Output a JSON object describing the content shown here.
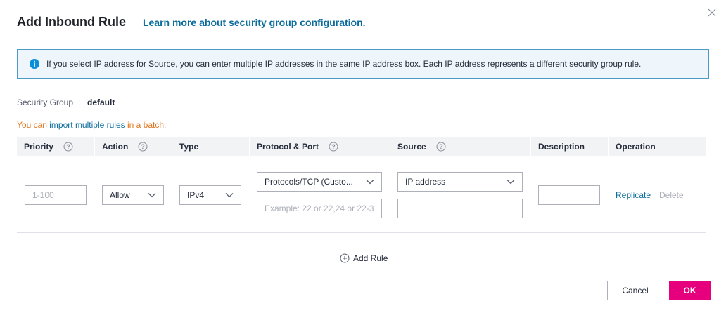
{
  "dialog": {
    "title": "Add Inbound Rule",
    "learn_more_link": "Learn more about security group configuration.",
    "close_icon": "close-icon"
  },
  "info": {
    "icon": "info-icon",
    "text": "If you select IP address for Source, you can enter multiple IP addresses in the same IP address box. Each IP address represents a different security group rule."
  },
  "security_group": {
    "label": "Security Group",
    "value": "default"
  },
  "batch": {
    "prefix": "You can ",
    "link": "import multiple rules",
    "suffix": " in a batch."
  },
  "table": {
    "headers": {
      "priority": "Priority",
      "action": "Action",
      "type": "Type",
      "protocol_port": "Protocol & Port",
      "source": "Source",
      "description": "Description",
      "operation": "Operation"
    },
    "row": {
      "priority_placeholder": "1-100",
      "priority_value": "",
      "action_value": "Allow",
      "type_value": "IPv4",
      "protocol_value": "Protocols/TCP (Custo...",
      "port_placeholder": "Example: 22 or 22,24 or 22-3",
      "source_type_value": "IP address",
      "source_value": "",
      "description_value": "",
      "replicate_label": "Replicate",
      "delete_label": "Delete"
    }
  },
  "add_rule_label": "Add Rule",
  "footer": {
    "cancel_label": "Cancel",
    "ok_label": "OK"
  },
  "colors": {
    "accent": "#e6007e",
    "link": "#0b6c9c",
    "batch_text": "#e1731a",
    "info_border": "#4a9bc7",
    "info_bg": "#eef6fb"
  }
}
